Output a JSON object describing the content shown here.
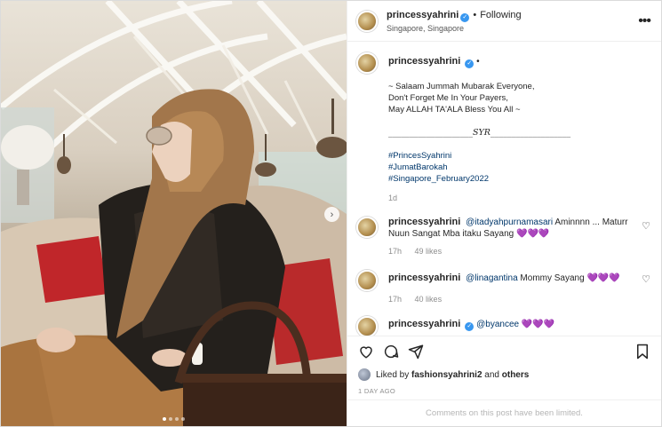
{
  "post": {
    "username": "princessyahrini",
    "follow_status": "Following",
    "location": "Singapore, Singapore",
    "more_icon": "more-options-icon"
  },
  "caption": {
    "username": "princessyahrini",
    "lines": [
      "~ Salaam Jummah Mubarak Everyone,",
      "Don't Forget Me In Your Payers,",
      "May ALLAH TA'ALA Bless You All ~",
      "",
      "____________________SYR___________________",
      "",
      "#PrincesSyahrini",
      "#JumatBarokah",
      "#Singapore_February2022"
    ],
    "age": "1d"
  },
  "comments": [
    {
      "username": "princessyahrini",
      "mention": "@itadyahpurnamasari",
      "text": "Aminnnn ... Maturr Nuun Sangat Mba itaku Sayang",
      "hearts": "💜💜💜",
      "age": "17h",
      "likes": "49 likes"
    },
    {
      "username": "princessyahrini",
      "mention": "@linagantina",
      "text": "Mommy Sayang",
      "hearts": "💜💜💜",
      "age": "17h",
      "likes": "40 likes"
    },
    {
      "username": "princessyahrini",
      "mention": "@byancee",
      "hearts": "💜💜💜"
    }
  ],
  "liked_by": {
    "prefix": "Liked by",
    "user": "fashionsyahrini2",
    "and": "and",
    "others": "others"
  },
  "date": "1 DAY AGO",
  "comments_limited": "Comments on this post have been limited.",
  "carousel": {
    "count": 4,
    "active": 1
  }
}
